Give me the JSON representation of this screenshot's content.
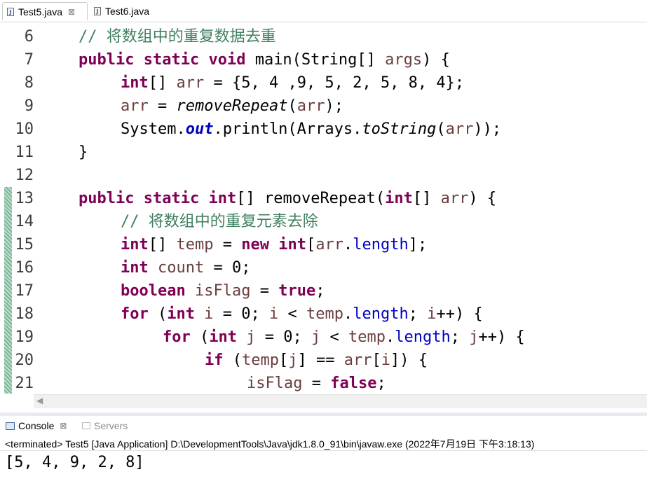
{
  "editor_tabs": [
    {
      "label": "Test5.java",
      "active": true,
      "close": "⊠"
    },
    {
      "label": "Test6.java",
      "active": false
    }
  ],
  "code_lines": [
    {
      "num": "6",
      "changed": false
    },
    {
      "num": "7",
      "changed": false
    },
    {
      "num": "8",
      "changed": false
    },
    {
      "num": "9",
      "changed": false
    },
    {
      "num": "10",
      "changed": false
    },
    {
      "num": "11",
      "changed": false
    },
    {
      "num": "12",
      "changed": false
    },
    {
      "num": "13",
      "changed": true
    },
    {
      "num": "14",
      "changed": true
    },
    {
      "num": "15",
      "changed": true
    },
    {
      "num": "16",
      "changed": true
    },
    {
      "num": "17",
      "changed": true
    },
    {
      "num": "18",
      "changed": true
    },
    {
      "num": "19",
      "changed": true
    },
    {
      "num": "20",
      "changed": true
    },
    {
      "num": "21",
      "changed": true
    }
  ],
  "code": {
    "c1": "// 将数组中的重复数据去重",
    "c2": "// 将数组中的重复元素去除",
    "kw_public": "public",
    "kw_static": "static",
    "kw_void": "void",
    "kw_int": "int",
    "kw_new": "new",
    "kw_boolean": "boolean",
    "kw_true": "true",
    "kw_false": "false",
    "kw_for": "for",
    "kw_if": "if",
    "v_args": "args",
    "v_arr": "arr",
    "v_temp": "temp",
    "v_count": "count",
    "v_isFlag": "isFlag",
    "v_i": "i",
    "v_j": "j",
    "f_length": "length",
    "f_out": "out",
    "m_removeRepeat": "removeRepeat",
    "m_toString": "toString",
    "t_main": " main(String[] ",
    "t_bracket_sp": "[] ",
    "t_array_init": " = {5, 4 ,9, 5, 2, 5, 8, 4};",
    "t_assign": " = ",
    "t_paren_open": "(",
    "t_paren_close_semi": ");",
    "t_system": "System.",
    "t_println": ".println(Arrays.",
    "t_close2": "));",
    "t_brace_close": "}",
    "t_brace_open_end": ") {",
    "t_sp": " ",
    "t_lbracket": "[",
    "t_dot": ".",
    "t_rbracket_semi": "];",
    "t_zero_semi": " = 0;",
    "t_semi": ";",
    "t_for_open": " (",
    "t_for_init": " = 0; ",
    "t_lt": " < ",
    "t_for_mid": "; ",
    "t_incr_i": "++) {",
    "t_incr_j": "++) {",
    "t_if_open": " (",
    "t_eq": "] == ",
    "t_if_close": "]) {"
  },
  "console": {
    "tab_console": "Console",
    "tab_console_close": "⊠",
    "tab_servers": "Servers",
    "status": "<terminated> Test5 [Java Application] D:\\DevelopmentTools\\Java\\jdk1.8.0_91\\bin\\javaw.exe (2022年7月19日 下午3:18:13)",
    "output": "[5, 4, 9, 2, 8]"
  },
  "scrollbar": {
    "left_arrow": "◀"
  }
}
